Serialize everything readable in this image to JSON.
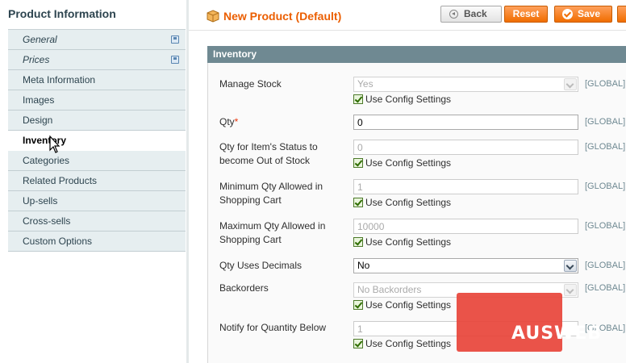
{
  "sidebar": {
    "title": "Product Information",
    "tabs": [
      {
        "label": "General"
      },
      {
        "label": "Prices"
      },
      {
        "label": "Meta Information"
      },
      {
        "label": "Images"
      },
      {
        "label": "Design"
      },
      {
        "label": "Inventory"
      },
      {
        "label": "Categories"
      },
      {
        "label": "Related Products"
      },
      {
        "label": "Up-sells"
      },
      {
        "label": "Cross-sells"
      },
      {
        "label": "Custom Options"
      }
    ]
  },
  "header": {
    "title": "New Product (Default)",
    "back_label": "Back",
    "reset_label": "Reset",
    "save_label": "Save"
  },
  "section": {
    "title": "Inventory",
    "config_label": "Use Config Settings",
    "scope_label": "[GLOBAL]",
    "fields": {
      "manage_stock": {
        "label": "Manage Stock",
        "value": "Yes"
      },
      "qty": {
        "label": "Qty",
        "required_mark": "*",
        "value": "0"
      },
      "out_of_stock": {
        "label": "Qty for Item's Status to become Out of Stock",
        "value": "0"
      },
      "min_qty": {
        "label": "Minimum Qty Allowed in Shopping Cart",
        "value": "1"
      },
      "max_qty": {
        "label": "Maximum Qty Allowed in Shopping Cart",
        "value": "10000"
      },
      "decimals": {
        "label": "Qty Uses Decimals",
        "value": "No"
      },
      "backorders": {
        "label": "Backorders",
        "value": "No Backorders"
      },
      "notify": {
        "label": "Notify for Quantity Below",
        "value": "1"
      }
    }
  },
  "watermark": {
    "text": "AUSWEB"
  },
  "colors": {
    "accent": "#eb5e00",
    "section_header": "#6f8992",
    "tab_bg": "#e6eef0"
  }
}
